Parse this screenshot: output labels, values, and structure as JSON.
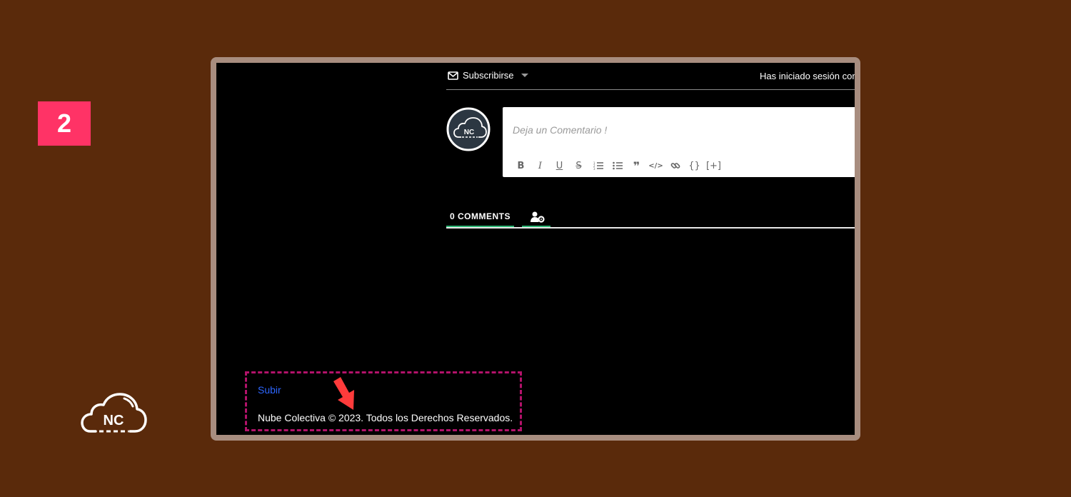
{
  "step": {
    "number": "2"
  },
  "brand": {
    "logo_text": "NC",
    "accent": "#ff3366",
    "background": "#5a2a0b"
  },
  "comments": {
    "subscribe_label": "Subscribirse",
    "logged_in_text": "Has iniciado sesión com",
    "avatar_text": "NC",
    "placeholder": "Deja un Comentario !",
    "toolbar": [
      "B",
      "I",
      "U",
      "S",
      "ordered-list",
      "unordered-list",
      "quote",
      "code",
      "link",
      "{}",
      "[+]"
    ],
    "count_tab": "0 COMMENTS",
    "accent": "#2bb673"
  },
  "footer": {
    "subir": "Subir",
    "copyright": "Nube Colectiva © 2023. Todos los Derechos Reservados.",
    "highlight": "#b3126a",
    "arrow": "#ff3b3b"
  }
}
